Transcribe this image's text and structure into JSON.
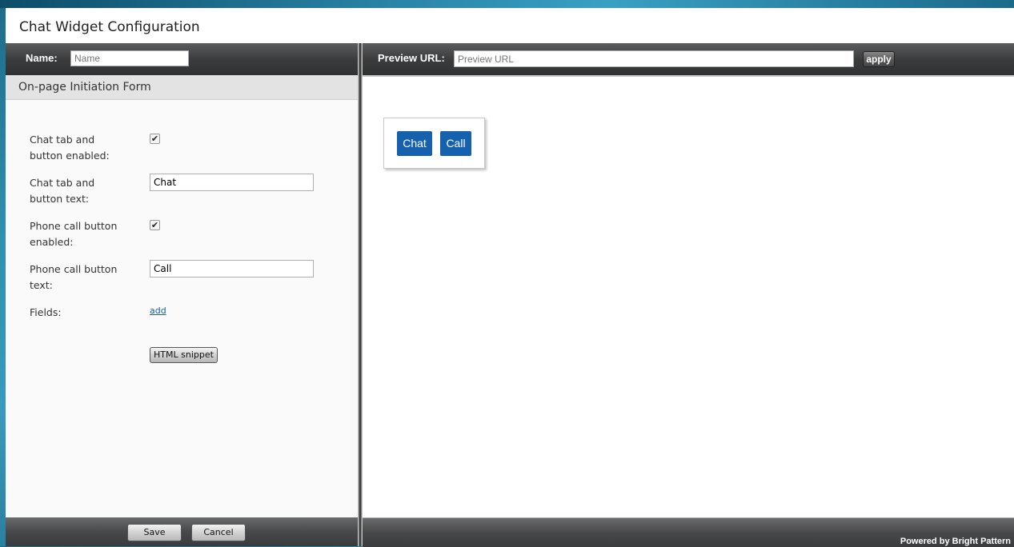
{
  "window": {
    "title": "Chat Widget Configuration"
  },
  "left_header": {
    "name_label": "Name:",
    "name_placeholder": "Name",
    "name_value": ""
  },
  "section": {
    "title": "On-page Initiation Form"
  },
  "form": {
    "chat_enabled_label": "Chat tab and button enabled:",
    "chat_enabled_checked": true,
    "chat_text_label": "Chat tab and button text:",
    "chat_text_value": "Chat",
    "phone_enabled_label": "Phone call button enabled:",
    "phone_enabled_checked": true,
    "phone_text_label": "Phone call button text:",
    "phone_text_value": "Call",
    "fields_label": "Fields:",
    "add_link": "add",
    "html_snippet_button": "HTML snippet"
  },
  "left_footer": {
    "save_button": "Save",
    "cancel_button": "Cancel"
  },
  "right_header": {
    "preview_label": "Preview URL:",
    "preview_placeholder": "Preview URL",
    "preview_value": "",
    "apply_button": "apply"
  },
  "preview": {
    "chat_button": "Chat",
    "call_button": "Call"
  },
  "right_footer": {
    "powered_by": "Powered by Bright Pattern"
  },
  "colors": {
    "accent": "#1561ad",
    "header_bg": "#3a3c3e"
  }
}
